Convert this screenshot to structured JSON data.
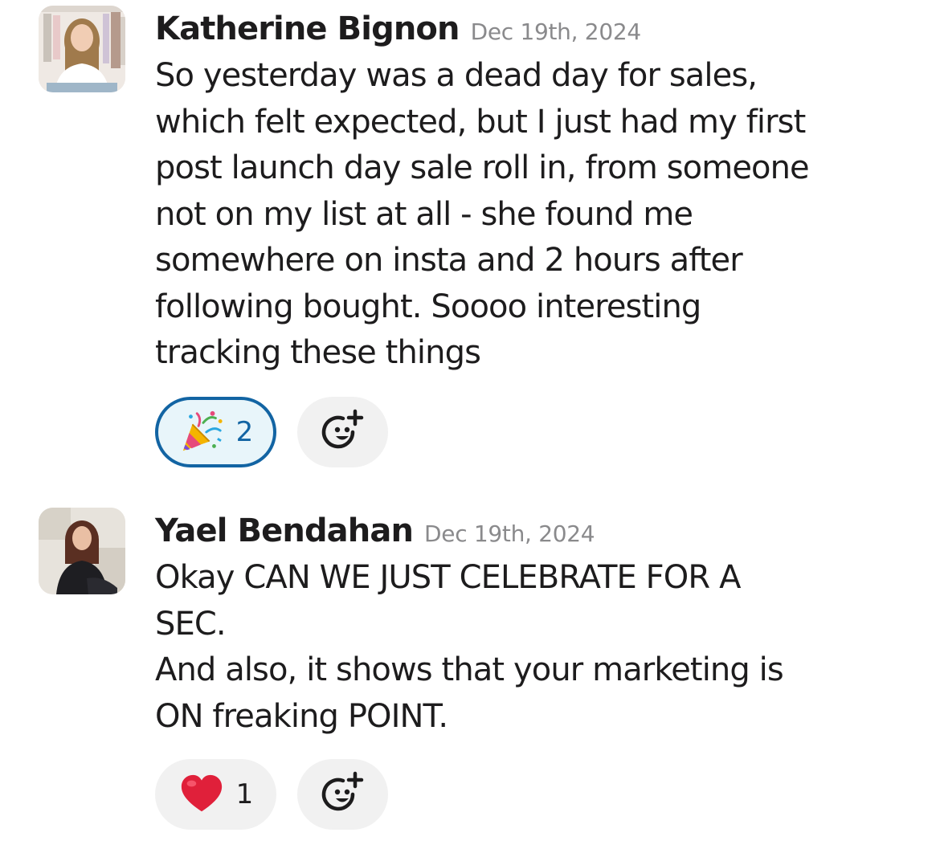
{
  "messages": [
    {
      "author": "Katherine Bignon",
      "timestamp": "Dec 19th, 2024",
      "text_lines": [
        "So yesterday was a dead day for sales,",
        "which felt expected, but I just had my first",
        "post launch day sale roll in, from someone",
        "not on my list at all - she found me",
        "somewhere on insta and 2 hours after",
        "following bought. Soooo interesting",
        "tracking these things"
      ],
      "reactions": [
        {
          "emoji": "party-popper-icon",
          "count": "2",
          "selected": true
        }
      ]
    },
    {
      "author": "Yael Bendahan",
      "timestamp": "Dec 19th, 2024",
      "text_lines": [
        "Okay CAN WE JUST CELEBRATE FOR A",
        "SEC.",
        "And also, it shows that your marketing is",
        "ON freaking POINT."
      ],
      "reactions": [
        {
          "emoji": "red-heart-icon",
          "count": "1",
          "selected": false
        }
      ]
    }
  ],
  "colors": {
    "text": "#1d1c1d",
    "timestamp": "#8a8a8c",
    "reaction_bg": "#f1f1f1",
    "selected_border": "#1264a3",
    "selected_bg": "#e8f5fa",
    "heart": "#e0203a"
  }
}
